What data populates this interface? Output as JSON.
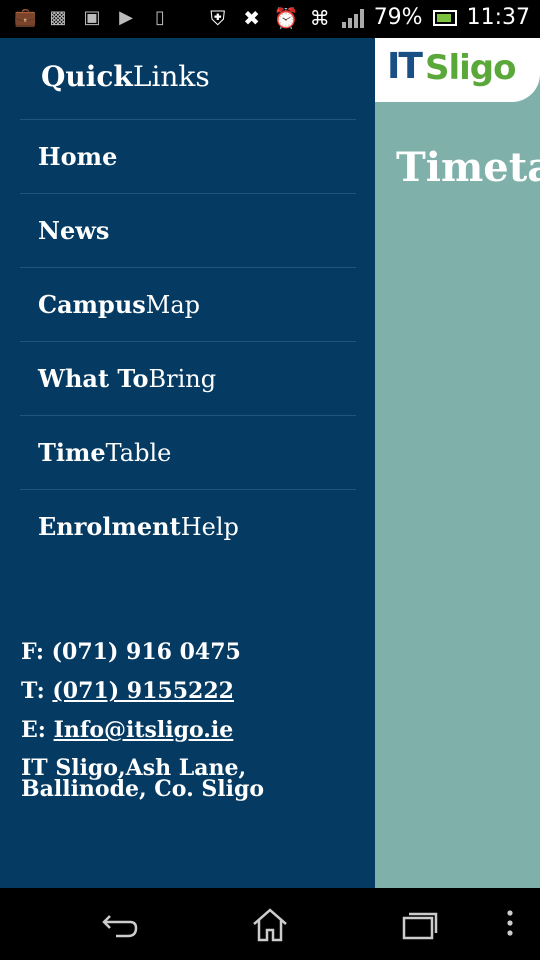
{
  "status_bar": {
    "battery": "79%",
    "time": "11:37"
  },
  "drawer": {
    "title_bold": "Quick",
    "title_regular": "Links",
    "items": [
      {
        "bold": "Home",
        "regular": ""
      },
      {
        "bold": "News",
        "regular": ""
      },
      {
        "bold": "Campus",
        "regular": "Map"
      },
      {
        "bold": "What To",
        "regular": "Bring"
      },
      {
        "bold": "Time",
        "regular": "Table"
      },
      {
        "bold": "Enrolment",
        "regular": "Help"
      }
    ],
    "contact": {
      "fax_label": "F:",
      "fax": "(071) 916 0475",
      "tel_label": "T:",
      "tel": "(071) 9155222",
      "email_label": "E:",
      "email": "Info@itsligo.ie",
      "address_line1": "IT Sligo,Ash Lane,",
      "address_line2": "Ballinode, Co. Sligo"
    }
  },
  "main": {
    "logo_it": "IT",
    "logo_sligo": "Sligo",
    "heading": "Timeta"
  },
  "colors": {
    "drawer_bg": "#053b63",
    "main_bg": "#7fb1aa",
    "logo_blue": "#1a4f86",
    "logo_green": "#5aa83a"
  }
}
